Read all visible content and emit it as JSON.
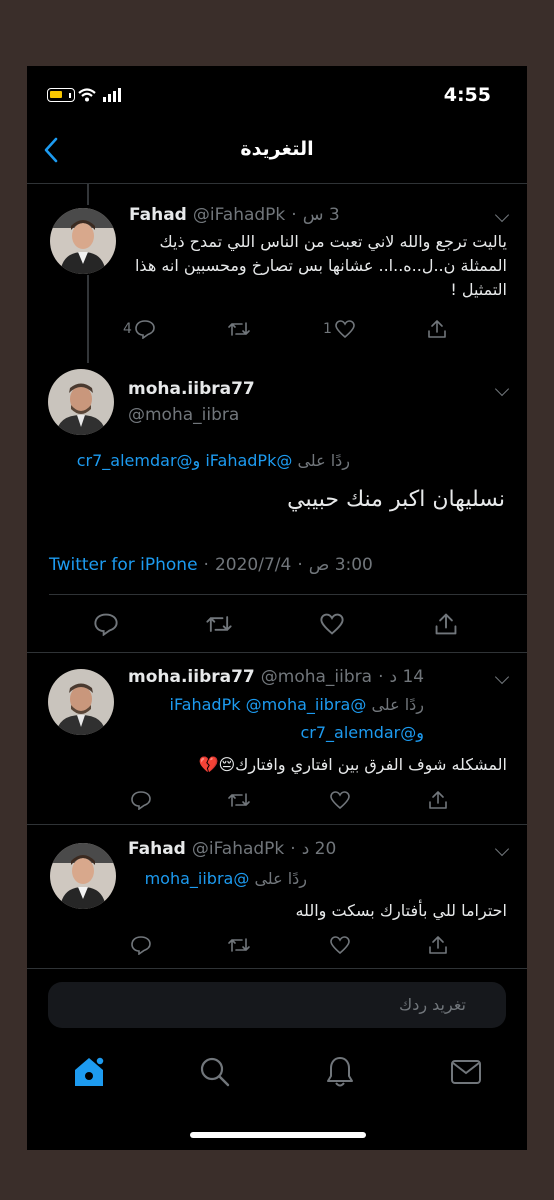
{
  "status": {
    "time": "4:55"
  },
  "header": {
    "title": "التغريدة"
  },
  "parent_tweet": {
    "name": "Fahad",
    "handle": "@iFahadPk",
    "time": "3 س",
    "text": "ياليت ترجع والله لاني تعبت من الناس اللي تمدح ذيك الممثلة ن..ل..ه..ا.. عشانها بس تصارخ ومحسبين انه هذا التمثيل !",
    "reply_count": "4",
    "like_count": "1"
  },
  "main_tweet": {
    "name": "moha.iibra77",
    "handle": "@moha_iibra",
    "reply_prefix": "ردًا على",
    "reply_to": "@iFahadPk و@cr7_alemdar",
    "text": "نسليهان اكبر منك حبيبي",
    "time": "3:00 ص",
    "date": "2020/7/4",
    "source": "Twitter for iPhone"
  },
  "replies": [
    {
      "name": "moha.iibra77",
      "handle": "@moha_iibra",
      "time": "14 د",
      "reply_prefix": "ردًا على",
      "reply_to_line1": "@iFahadPk @moha_iibra",
      "reply_to_line2": "و@cr7_alemdar",
      "text": "المشكله شوف الفرق بين افتاري وافتارك😔💔"
    },
    {
      "name": "Fahad",
      "handle": "@iFahadPk",
      "time": "20 د",
      "reply_prefix": "ردًا على",
      "reply_to_line1": "@moha_iibra",
      "text": "احتراما للي بأفتارك بسكت والله"
    }
  ],
  "compose": {
    "placeholder": "تغريد ردك"
  },
  "tabbar": [
    "home-icon",
    "search-icon",
    "bell-icon",
    "mail-icon"
  ],
  "colors": {
    "accent": "#1d9bf0",
    "background": "#000000",
    "muted": "#71767b"
  }
}
